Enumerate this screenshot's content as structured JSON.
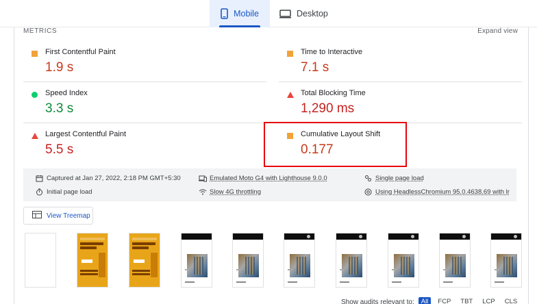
{
  "tabs": {
    "mobile": "Mobile",
    "desktop": "Desktop"
  },
  "metrics_section": {
    "title": "METRICS",
    "expand_label": "Expand view"
  },
  "metrics": [
    {
      "label": "First Contentful Paint",
      "value": "1.9 s",
      "status": "average"
    },
    {
      "label": "Time to Interactive",
      "value": "7.1 s",
      "status": "average"
    },
    {
      "label": "Speed Index",
      "value": "3.3 s",
      "status": "good"
    },
    {
      "label": "Total Blocking Time",
      "value": "1,290 ms",
      "status": "poor"
    },
    {
      "label": "Largest Contentful Paint",
      "value": "5.5 s",
      "status": "poor"
    },
    {
      "label": "Cumulative Layout Shift",
      "value": "0.177",
      "status": "average"
    }
  ],
  "summary": {
    "captured": "Captured at Jan 27, 2022, 2:18 PM GMT+5:30",
    "device": "Emulated Moto G4 with Lighthouse 9.0.0",
    "session": "Single page load",
    "load": "Initial page load",
    "throttling": "Slow 4G throttling",
    "browser": "Using HeadlessChromium 95.0.4638.69 with lr"
  },
  "treemap_button": "View Treemap",
  "filmstrip_brand_text": "SINGHAL GROUP",
  "filter": {
    "label": "Show audits relevant to:",
    "chips": [
      "All",
      "FCP",
      "TBT",
      "LCP",
      "CLS"
    ],
    "active": "All"
  },
  "colors": {
    "accent": "#1a56c4",
    "average": "#c5391b",
    "good": "#0d8a3a",
    "poor": "#c5221f",
    "highlight": "#e8000b"
  }
}
